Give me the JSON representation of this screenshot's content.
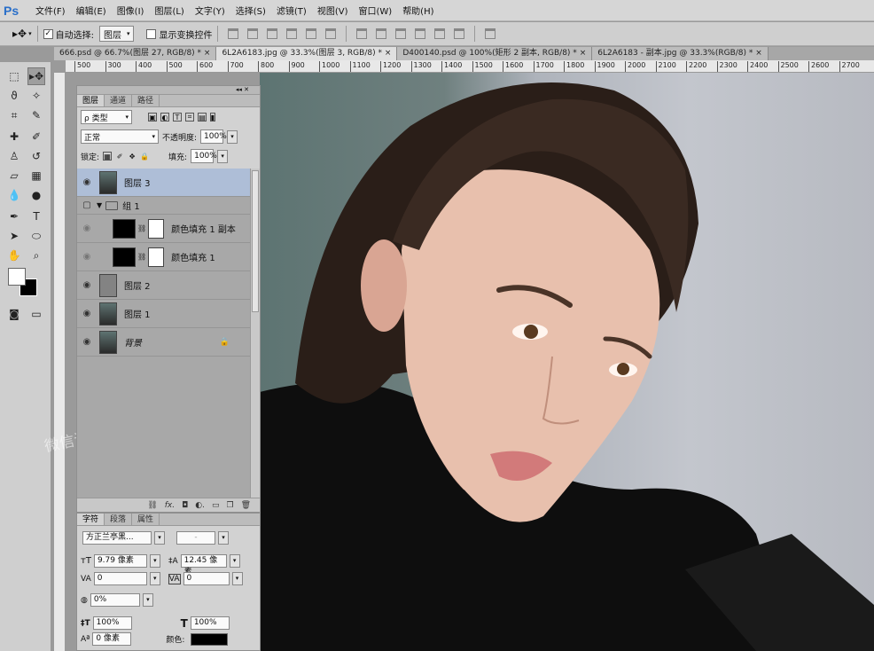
{
  "app": {
    "logo": "Ps"
  },
  "menu": [
    "文件(F)",
    "编辑(E)",
    "图像(I)",
    "图层(L)",
    "文字(Y)",
    "选择(S)",
    "滤镜(T)",
    "视图(V)",
    "窗口(W)",
    "帮助(H)"
  ],
  "options": {
    "auto_select_label": "自动选择:",
    "auto_select_value": "图层",
    "show_transform_label": "显示变换控件"
  },
  "tabs": [
    "666.psd @ 66.7%(图层 27, RGB/8) *",
    "6L2A6183.jpg @ 33.3%(图层 3, RGB/8) *",
    "D400140.psd @ 100%(矩形 2 副本, RGB/8) *",
    "6L2A6183 - 副本.jpg @ 33.3%(RGB/8) *"
  ],
  "ruler_ticks": [
    "500",
    "300",
    "400",
    "500",
    "600",
    "700",
    "800",
    "900",
    "1000",
    "1100",
    "1200",
    "1300",
    "1400",
    "1500",
    "1600",
    "1700",
    "1800",
    "1900",
    "2000",
    "2100",
    "2200",
    "2300",
    "2400",
    "2500",
    "2600",
    "2700"
  ],
  "layers_panel": {
    "tabs": [
      "图层",
      "通道",
      "路径"
    ],
    "filter_label": "ρ 类型",
    "blend_mode": "正常",
    "opacity_label": "不透明度:",
    "opacity_value": "100%",
    "lock_label": "锁定:",
    "fill_label": "填充:",
    "fill_value": "100%",
    "layers": [
      {
        "name": "图层 3"
      },
      {
        "name": "组 1"
      },
      {
        "name": "颜色填充 1 副本"
      },
      {
        "name": "颜色填充 1"
      },
      {
        "name": "图层 2"
      },
      {
        "name": "图层 1"
      },
      {
        "name": "背景"
      }
    ]
  },
  "char_panel": {
    "tabs": [
      "字符",
      "段落",
      "属性"
    ],
    "font_family": "方正兰亭黑...",
    "font_style": "-",
    "size": "9.79 像素",
    "leading": "12.45 像素",
    "kerning": "0",
    "tracking": "0",
    "scale_tsume": "0%",
    "vertical_scale": "100%",
    "horizontal_scale": "100%",
    "baseline_shift": "0 像素",
    "color_label": "颜色:"
  },
  "watermark": "微信订阅号：逻辑设计学",
  "colors": {
    "foreground": "#000000",
    "background": "#ffffff",
    "selected_layer": "#aebed7"
  }
}
